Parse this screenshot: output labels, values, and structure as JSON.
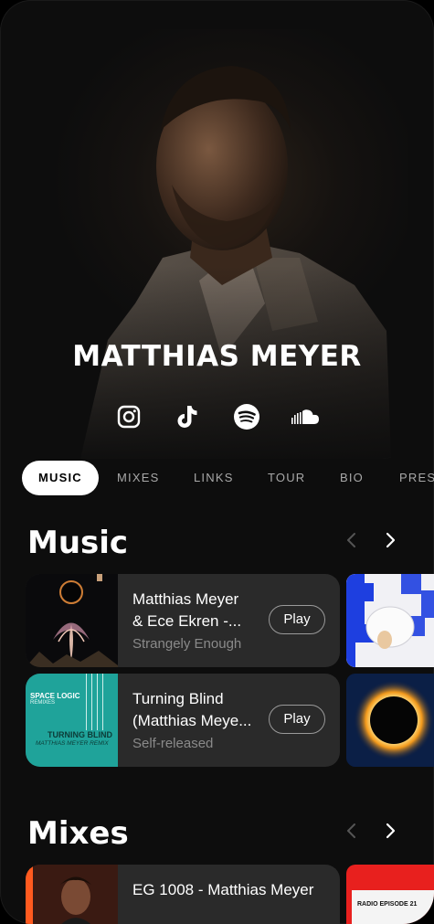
{
  "artist": {
    "name": "MATTHIAS MEYER"
  },
  "socials": [
    {
      "icon": "instagram-icon"
    },
    {
      "icon": "tiktok-icon"
    },
    {
      "icon": "spotify-icon"
    },
    {
      "icon": "soundcloud-icon"
    }
  ],
  "tabs": [
    {
      "label": "MUSIC",
      "active": true
    },
    {
      "label": "MIXES"
    },
    {
      "label": "LINKS"
    },
    {
      "label": "TOUR"
    },
    {
      "label": "BIO"
    },
    {
      "label": "PRES"
    }
  ],
  "music": {
    "title": "Music",
    "items": [
      {
        "title_line1": "Matthias Meyer",
        "title_line2": "& Ece Ekren -...",
        "subtitle": "Strangely Enough",
        "play_label": "Play"
      },
      {
        "title_line1": "Turning Blind",
        "title_line2": "(Matthias Meye...",
        "subtitle": "Self-released",
        "play_label": "Play"
      }
    ],
    "cover_text": {
      "label_top": "SPACE LOGIC",
      "label_sub": "REMIXES",
      "title": "TURNING BLIND",
      "remix": "MATTHIAS MEYER REMIX"
    }
  },
  "mixes": {
    "title": "Mixes",
    "items": [
      {
        "title_line1": "EG 1008 - Matthias Meyer"
      }
    ],
    "side_cover_text": "RADIO EPISODE 21"
  },
  "colors": {
    "background": "#0d0d0d",
    "card": "#2a2a2a",
    "active_tab": "#ffffff",
    "muted": "#8a8a8a"
  }
}
